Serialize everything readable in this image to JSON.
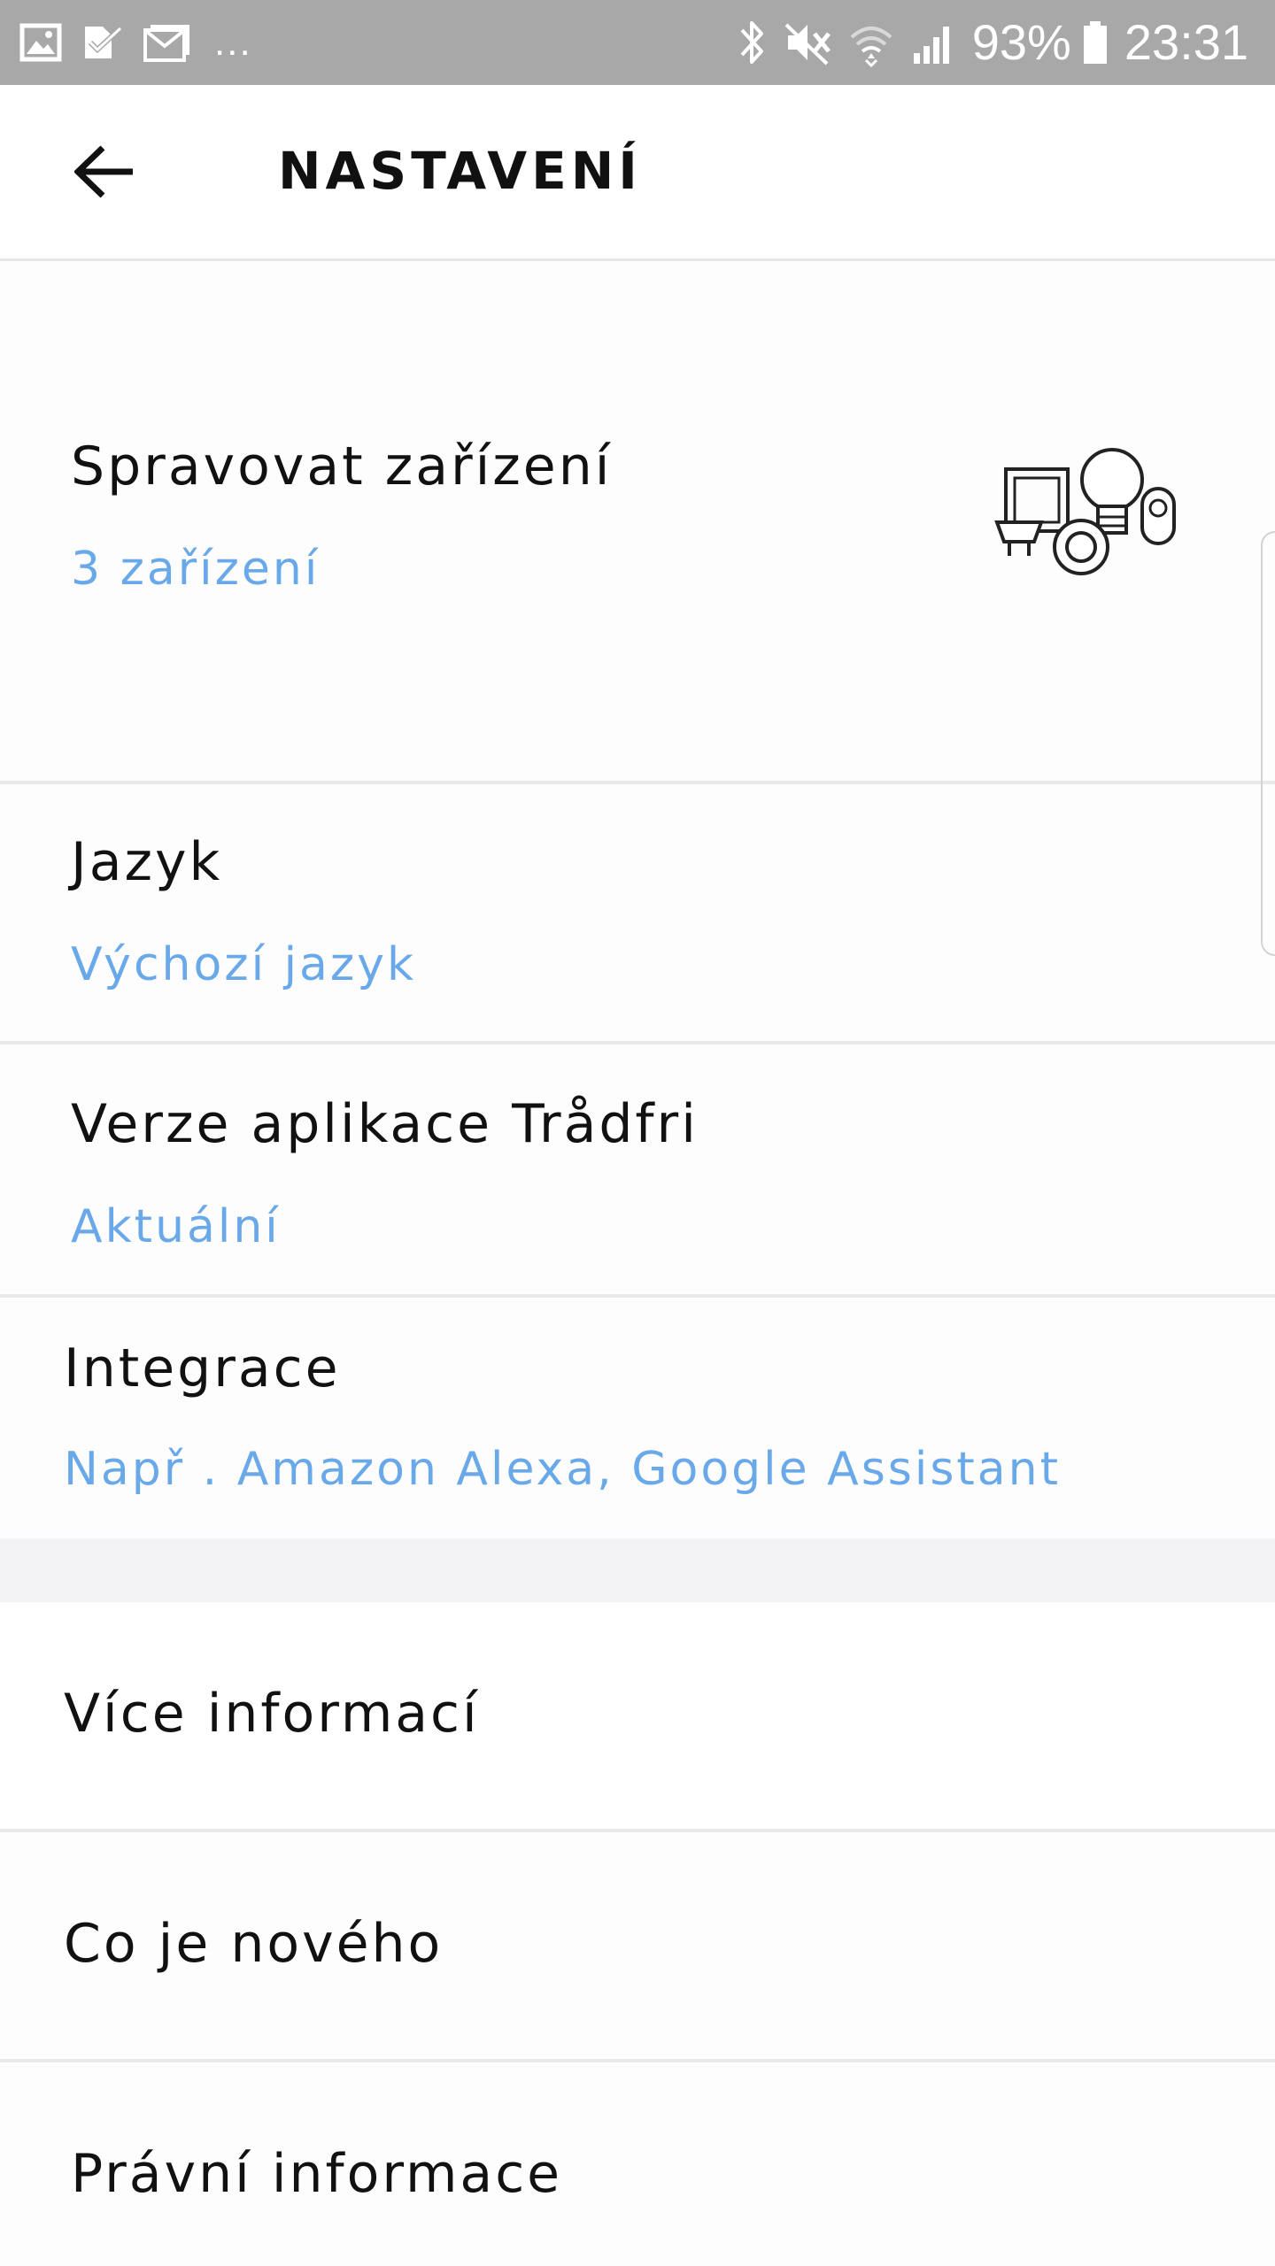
{
  "status_bar": {
    "notification_icons": [
      "image-icon",
      "task-check-icon",
      "mail-icon"
    ],
    "more_notifications": "...",
    "system_icons": [
      "bluetooth-icon",
      "mute-icon",
      "wifi-icon",
      "signal-icon",
      "battery-icon"
    ],
    "battery": "93%",
    "time": "23:31"
  },
  "app_bar": {
    "back_icon": "arrow-left-icon",
    "title": "NASTAVENÍ"
  },
  "settings": {
    "manage_devices": {
      "title": "Spravovat zařízení",
      "subtitle": "3 zařízení",
      "illustration": "devices-illustration"
    },
    "language": {
      "title": "Jazyk",
      "subtitle": "Výchozí jazyk"
    },
    "app_version": {
      "title": "Verze aplikace Trådfri",
      "subtitle": "Aktuální"
    },
    "integration": {
      "title": "Integrace",
      "subtitle": "Např . Amazon Alexa, Google Assistant"
    }
  },
  "info_links": {
    "more_info": "Více informací",
    "whats_new": "Co je nového",
    "legal": "Právní informace"
  },
  "colors": {
    "status_bar": "#a8a8a8",
    "accent_subtitle": "#6aa9e9",
    "divider": "#e9e9e9",
    "section_gap": "#f3f3f5"
  }
}
